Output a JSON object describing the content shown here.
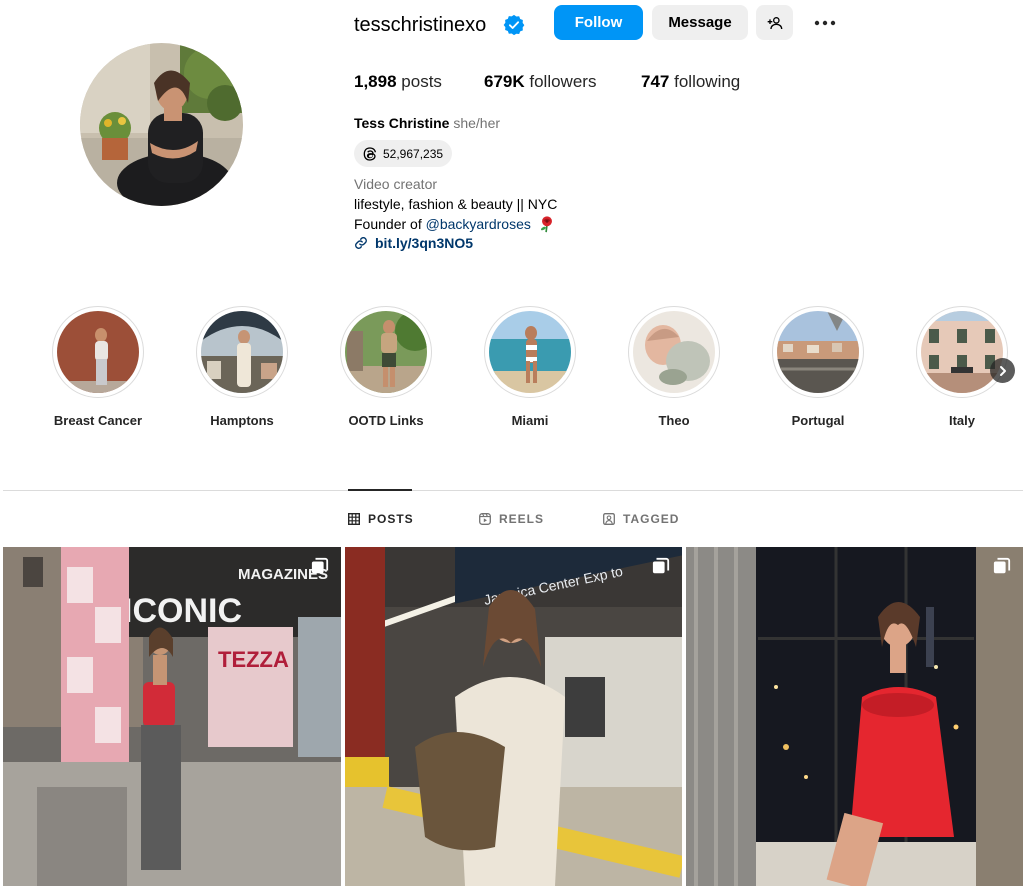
{
  "profile": {
    "username": "tesschristinexo",
    "verified": true,
    "full_name": "Tess Christine",
    "pronouns": "she/her",
    "threads_count": "52,967,235",
    "category": "Video creator",
    "bio_line1": "lifestyle, fashion & beauty || NYC",
    "bio_line2_prefix": "Founder of ",
    "bio_mention": "@backyardroses",
    "bio_emoji": "rose-icon",
    "link": "bit.ly/3qn3NO5"
  },
  "actions": {
    "follow": "Follow",
    "message": "Message"
  },
  "stats": {
    "posts_value": "1,898",
    "posts_label": "posts",
    "followers_value": "679K",
    "followers_label": "followers",
    "following_value": "747",
    "following_label": "following"
  },
  "highlights": [
    {
      "label": "Breast Cancer"
    },
    {
      "label": "Hamptons"
    },
    {
      "label": "OOTD Links"
    },
    {
      "label": "Miami"
    },
    {
      "label": "Theo"
    },
    {
      "label": "Portugal"
    },
    {
      "label": "Italy"
    }
  ],
  "tabs": {
    "posts": "POSTS",
    "reels": "REELS",
    "tagged": "TAGGED"
  },
  "posts": [
    {
      "type": "carousel",
      "scene": "street-newsstand"
    },
    {
      "type": "carousel",
      "scene": "subway-platform"
    },
    {
      "type": "carousel",
      "scene": "city-window-night"
    }
  ],
  "colors": {
    "accent": "#0095f6",
    "button_gray": "#efefef",
    "link": "#00376b",
    "muted": "#737373"
  }
}
